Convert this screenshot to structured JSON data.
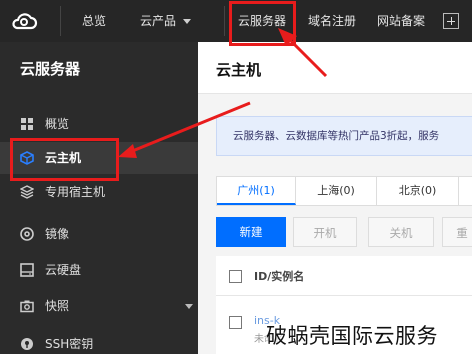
{
  "topbar": {
    "logo_icon": "cloud-icon",
    "nav": [
      {
        "label": "总览"
      },
      {
        "label": "云产品"
      },
      {
        "label": "云服务器"
      },
      {
        "label": "域名注册"
      },
      {
        "label": "网站备案"
      }
    ],
    "plus_icon": "plus-icon"
  },
  "sidebar": {
    "title": "云服务器",
    "items": [
      {
        "label": "概览",
        "icon": "grid-icon"
      },
      {
        "label": "云主机",
        "icon": "cube-icon",
        "active": true
      },
      {
        "label": "专用宿主机",
        "icon": "layers-icon"
      },
      {
        "label": "镜像",
        "icon": "disc-icon"
      },
      {
        "label": "云硬盘",
        "icon": "disk-icon"
      },
      {
        "label": "快照",
        "icon": "camera-icon"
      },
      {
        "label": "SSH密钥",
        "icon": "key-icon"
      }
    ]
  },
  "main": {
    "title": "云主机",
    "notice": "云服务器、云数据库等热门产品3折起，服务",
    "tabs": [
      {
        "label": "广州(1)",
        "active": true
      },
      {
        "label": "上海(0)"
      },
      {
        "label": "北京(0)"
      }
    ],
    "buttons": {
      "new": "新建",
      "start": "开机",
      "stop": "关机",
      "restart": "重"
    },
    "table": {
      "header": "ID/实例名",
      "row_id": "ins-k",
      "row_name": "未命名"
    }
  },
  "watermark": "破蜗壳国际云服务",
  "colors": {
    "accent": "#006eff",
    "highlight": "#e81c1c",
    "topbar_bg": "#262626",
    "sidebar_bg": "#2b2b2b"
  }
}
